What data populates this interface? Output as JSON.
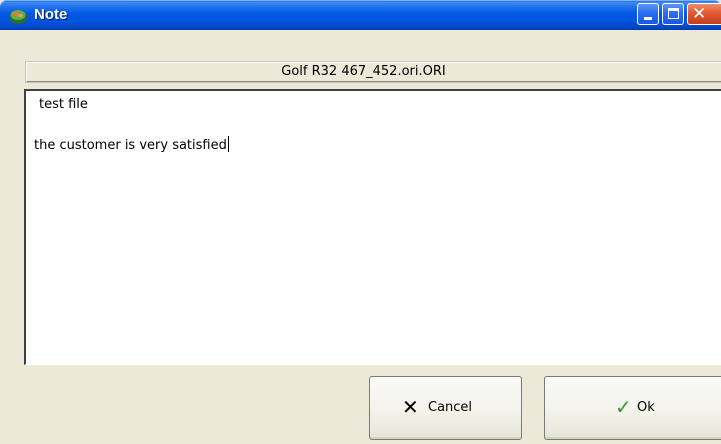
{
  "window": {
    "title": "Note",
    "icon": "note-app-icon",
    "controls": [
      "minimize-icon",
      "maximize-icon",
      "close-icon"
    ]
  },
  "file_header": {
    "filename": "Golf R32 467_452.ori.ORI"
  },
  "memo": {
    "lines": [
      "test file",
      "the customer is very satisfied"
    ]
  },
  "buttons": {
    "cancel_label": "Cancel",
    "cancel_icon": "x-icon",
    "ok_label": "Ok",
    "ok_icon": "checkmark-icon"
  },
  "colors": {
    "titlebar": "#0054df",
    "face": "#ece9d8",
    "ok_check": "#2fa12b",
    "close_button": "#e05a33"
  }
}
